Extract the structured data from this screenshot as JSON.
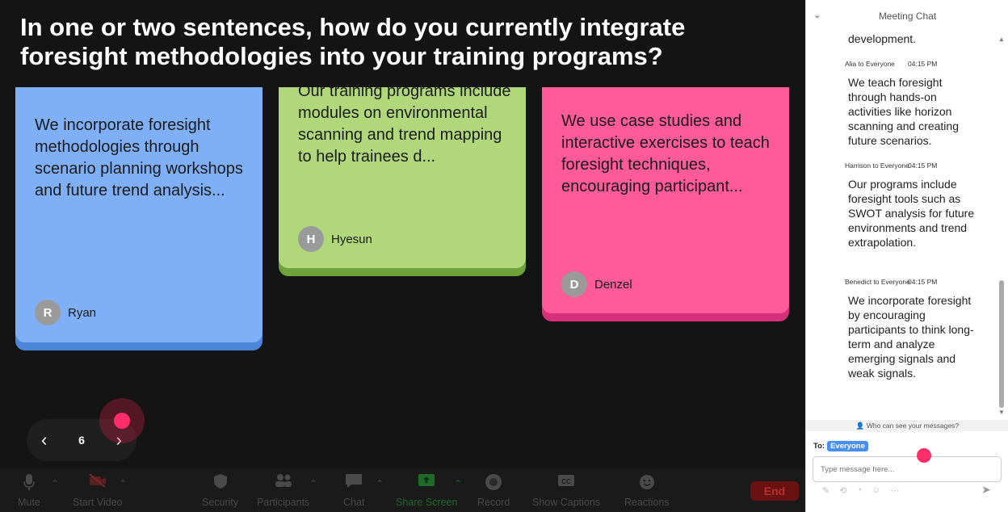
{
  "question": "In one or two sentences, how do you currently integrate foresight methodologies into your training programs?",
  "notes": [
    {
      "text": "We incorporate foresight methodologies through scenario planning workshops and future trend analysis...",
      "initial": "R",
      "author": "Ryan",
      "color": "#7eaff7"
    },
    {
      "text": "Our training programs include modules on environmental scanning and trend mapping to help trainees d...",
      "initial": "H",
      "author": "Hyesun",
      "color": "#b0d87a"
    },
    {
      "text": "We use case studies and interactive exercises to teach foresight techniques, encouraging participant...",
      "initial": "D",
      "author": "Denzel",
      "color": "#ff5a9a"
    }
  ],
  "pager": {
    "prev": "‹",
    "page": "6",
    "next": "›"
  },
  "toolbar": {
    "mute": "Mute",
    "start_video": "Start Video",
    "security": "Security",
    "participants": "Participants",
    "chat": "Chat",
    "share_screen": "Share Screen",
    "record": "Record",
    "show_captions": "Show Captions",
    "reactions": "Reactions",
    "end": "End"
  },
  "chat": {
    "title": "Meeting Chat",
    "partial_text": "development.",
    "messages": [
      {
        "sender": "Alia to Everyone",
        "time": "04:15 PM",
        "text": "We teach foresight through hands-on activities like horizon scanning and creating future scenarios."
      },
      {
        "sender": "Harrison to Everyone",
        "time": "04:15 PM",
        "text": "Our programs include foresight tools such as SWOT analysis for future environments and trend extrapolation."
      },
      {
        "sender": "Benedict to Everyone",
        "time": "04:15 PM",
        "text": "We incorporate foresight by encouraging participants to think long-term and analyze emerging signals and weak signals."
      }
    ],
    "who_can_see": "Who can see your messages?",
    "to_label": "To:",
    "to_value": "Everyone",
    "input_placeholder": "Type message here..."
  }
}
